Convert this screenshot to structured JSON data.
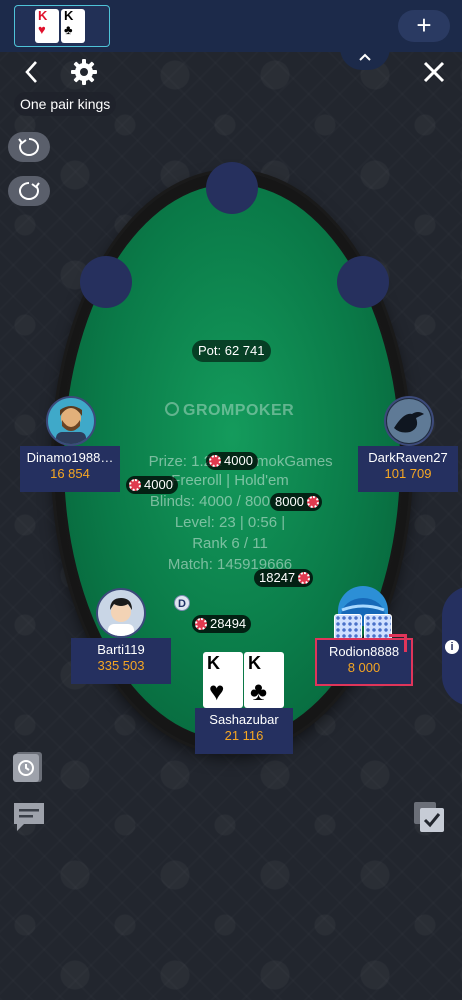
{
  "top_bar": {
    "tab_cards": [
      {
        "rank": "K",
        "suit": "♥",
        "color": "red"
      },
      {
        "rank": "K",
        "suit": "♣",
        "color": "black"
      }
    ],
    "add_table_label": "+",
    "collapse_label": "^"
  },
  "controls": {
    "back_icon": "chevron-left-icon",
    "settings_icon": "gear-icon",
    "close_icon": "close-icon",
    "hand_name": "One pair kings",
    "undo_icon": "rotate-ccw-icon",
    "redo_icon": "rotate-cw-icon"
  },
  "table": {
    "pot": "Pot: 62 741",
    "logo": "GROMPOKER",
    "info_lines": [
      "Prize: 1.2K",
      "mokGames",
      "Freeroll | Hold'em",
      "Blinds: 4000 / 800",
      "Level: 23 | 0:56 |",
      "Rank 6 / 11",
      "Match: 145919666"
    ],
    "dealer_label": "D"
  },
  "bets": [
    {
      "id": "bet-top-center",
      "amount": "4000"
    },
    {
      "id": "bet-dinamo",
      "amount": "4000"
    },
    {
      "id": "bet-darkraven",
      "amount": "8000"
    },
    {
      "id": "bet-rodion",
      "amount": "18247"
    },
    {
      "id": "bet-barti",
      "amount": "28494"
    }
  ],
  "players": [
    {
      "name": "Dinamo1988…",
      "stack": "16 854"
    },
    {
      "name": "DarkRaven27",
      "stack": "101 709"
    },
    {
      "name": "Barti119",
      "stack": "335 503"
    },
    {
      "name": "Rodion8888",
      "stack": "8 000"
    },
    {
      "name": "Sashazubar",
      "stack": "21 116"
    }
  ],
  "hero_cards": [
    {
      "rank": "K",
      "suit": "♥",
      "color": "red"
    },
    {
      "rank": "K",
      "suit": "♣",
      "color": "black"
    }
  ],
  "bottom": {
    "history_icon": "history-icon",
    "chat_icon": "chat-icon",
    "tables_icon": "multi-table-check-icon",
    "info_icon": "info-icon",
    "info_label": "i"
  },
  "colors": {
    "felt": "#0a7a48",
    "plate": "#253060",
    "stack": "#f5a623",
    "highlight": "#e0355a",
    "top_bar": "#1c2a4a"
  }
}
